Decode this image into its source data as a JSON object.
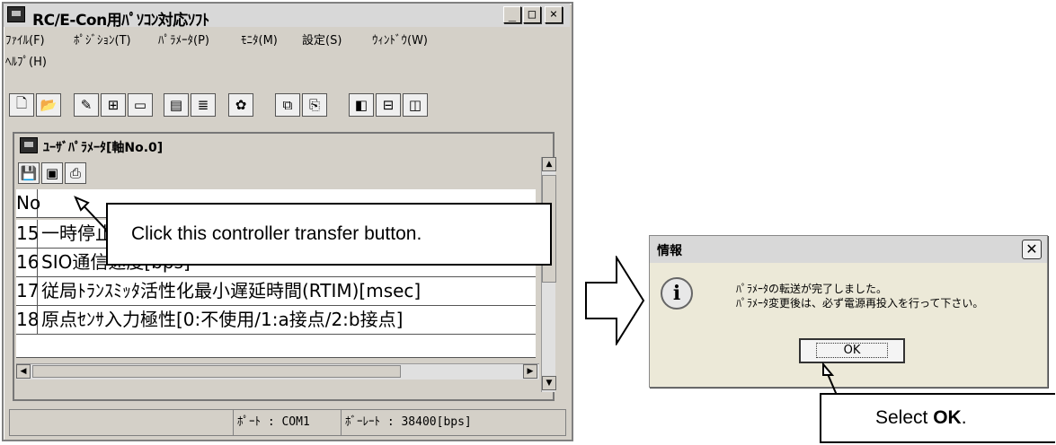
{
  "app": {
    "title": "RC/E-Con用ﾊﾟｿｺﾝ対応ｿﾌﾄ",
    "menu": [
      "ﾌｧｲﾙ(F)",
      "ﾎﾟｼﾞｼｮﾝ(T)",
      "ﾊﾟﾗﾒｰﾀ(P)",
      "ﾓﾆﾀ(M)",
      "設定(S)",
      "ｳｨﾝﾄﾞｳ(W)",
      "ﾍﾙﾌﾟ(H)"
    ],
    "window_buttons": [
      "_",
      "□",
      "×"
    ]
  },
  "param_window": {
    "title": "ﾕｰｻﾞﾊﾟﾗﾒｰﾀ[軸No.0]",
    "header_no": "No",
    "rows": [
      {
        "no": "15",
        "text": "一時停止入力無効選択"
      },
      {
        "no": "16",
        "text": "SIO通信速度[bps]"
      },
      {
        "no": "17",
        "text": "従局ﾄﾗﾝｽﾐｯﾀ活性化最小遅延時間(RTIM)[msec]"
      },
      {
        "no": "18",
        "text": "原点ｾﾝｻ入力極性[0:不使用/1:a接点/2:b接点]"
      }
    ]
  },
  "status": {
    "port": "ﾎﾟｰﾄ : COM1",
    "baud": "ﾎﾞｰﾚｰﾄ : 38400[bps]"
  },
  "callouts": {
    "transfer": "Click this controller transfer button.",
    "ok_prefix": "Select ",
    "ok_bold": "OK",
    "ok_suffix": "."
  },
  "dialog": {
    "title": "情報",
    "line1": "ﾊﾟﾗﾒｰﾀの転送が完了しました。",
    "line2": "ﾊﾟﾗﾒｰﾀ変更後は、必ず電源再投入を行って下さい。",
    "ok_label": "OK"
  }
}
